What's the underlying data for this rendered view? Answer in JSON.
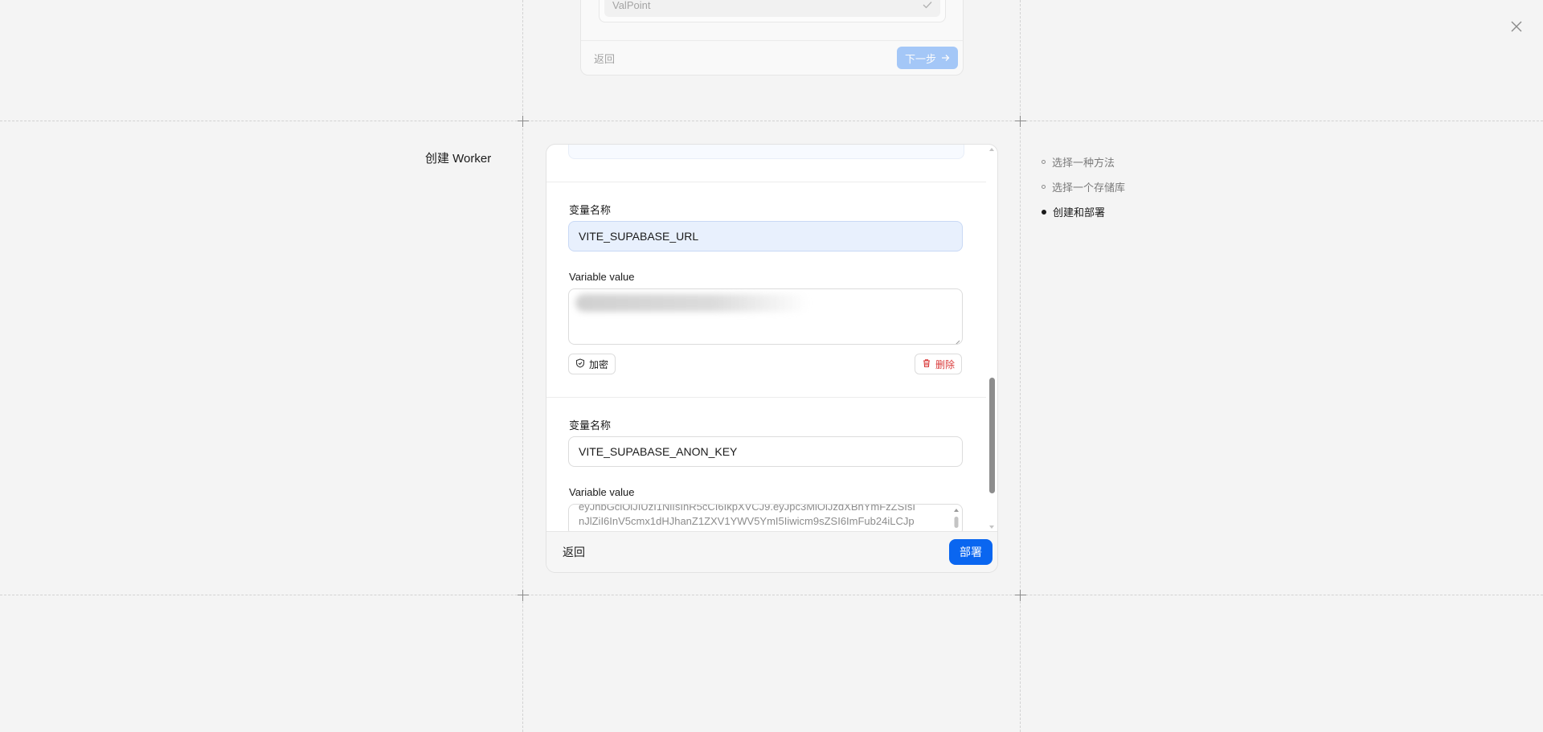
{
  "previous_step": {
    "selected_repo": "ValPoint",
    "back_label": "返回",
    "next_label": "下一步"
  },
  "step_title": "创建 Worker",
  "variables": [
    {
      "name_label": "变量名称",
      "name_value": "VITE_SUPABASE_URL",
      "value_label": "Variable value",
      "value": "",
      "encrypt_label": "加密",
      "delete_label": "删除"
    },
    {
      "name_label": "变量名称",
      "name_value": "VITE_SUPABASE_ANON_KEY",
      "value_label": "Variable value",
      "value_lines": [
        "eyJhbGciOiJIUzI1NiIsInR5cCI6IkpXVCJ9.eyJpc3MiOiJzdXBhYmFzZSIsI",
        "nJlZiI6InV5cmx1dHJhanZ1ZXV1YWV5YmI5Iiwicm9sZSI6ImFub24iLCJp"
      ]
    }
  ],
  "footer": {
    "back_label": "返回",
    "deploy_label": "部署"
  },
  "steps_nav": [
    {
      "label": "选择一种方法",
      "state": "done"
    },
    {
      "label": "选择一个存储库",
      "state": "done"
    },
    {
      "label": "创建和部署",
      "state": "active"
    }
  ]
}
